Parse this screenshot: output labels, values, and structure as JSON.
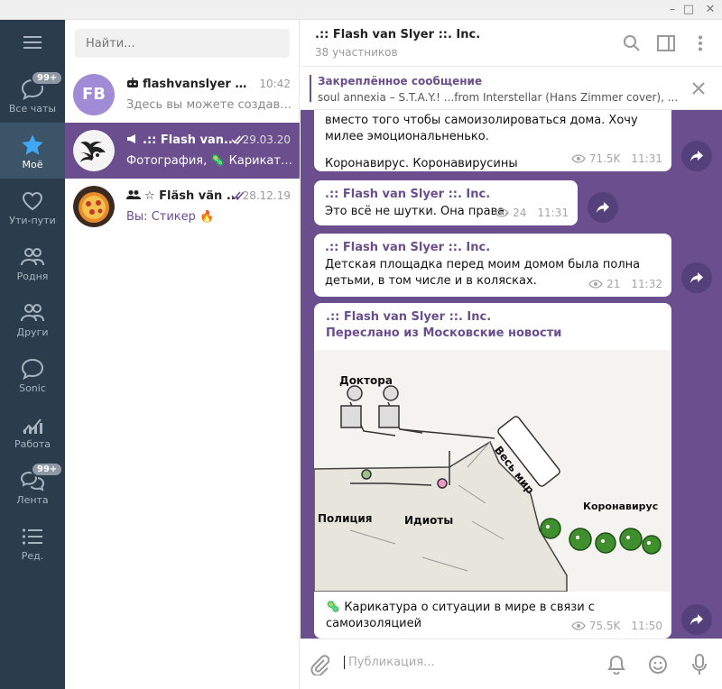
{
  "window": {
    "minimize": "–",
    "maximize": "□",
    "close": "✕"
  },
  "colors": {
    "accent": "#6a4e8e",
    "rail": "#2b3d4d",
    "forward": "#54407a"
  },
  "folders": [
    {
      "label": "Все чаты",
      "icon": "chat-bubble-icon",
      "badge": "99+"
    },
    {
      "label": "Моё",
      "icon": "star-icon",
      "active": true
    },
    {
      "label": "Ути-пути",
      "icon": "heart-icon"
    },
    {
      "label": "Родня",
      "icon": "people-icon"
    },
    {
      "label": "Други",
      "icon": "people-icon"
    },
    {
      "label": "Sonic",
      "icon": "chat-bubble-icon"
    },
    {
      "label": "Работа",
      "icon": "chart-icon"
    },
    {
      "label": "Лента",
      "icon": "chat-bubbles-icon",
      "badge": "99+"
    },
    {
      "label": "Ред.",
      "icon": "list-icon"
    }
  ],
  "search": {
    "placeholder": "Найти..."
  },
  "chats": [
    {
      "avatar": "FB",
      "name": "flashvanslyer bot",
      "time": "10:42",
      "preview": "Здесь вы можете создавать..."
    },
    {
      "name": ".:: Flash van...",
      "time": "29.03.20",
      "preview": "Фотография, 🦠 Карикатур..."
    },
    {
      "name": "☆ Fläsh vän ...",
      "time": "28.12.19",
      "preview": "Вы: Стикер 🔥"
    }
  ],
  "header": {
    "title": ".:: Flash van Slyer ::. Inc.",
    "subtitle": "38 участников"
  },
  "pinned": {
    "title": "Закреплённое сообщение",
    "text": "soul annexia – S.T.A.Y.! ...from Interstellar (Hans Zimmer cover), ..."
  },
  "messages": [
    {
      "text_top": "вместо того чтобы самоизолироваться дома. Хочу милее эмоциональненько.",
      "text": "Коронавирус. Коронавирусины",
      "views": "71.5K",
      "time": "11:31"
    },
    {
      "author": ".:: Flash van Slyer ::. Inc.",
      "text": "Это всё не шутки. Она права.",
      "views": "24",
      "time": "11:31"
    },
    {
      "author": ".:: Flash van Slyer ::. Inc.",
      "text": "Детская площадка перед моим домом была полна детьми, в том числе и в колясках.",
      "views": "21",
      "time": "11:32"
    },
    {
      "author": ".:: Flash van Slyer ::. Inc.",
      "forwarded": "Переслано из Московские новости",
      "image_labels": {
        "doctors": "Доктора",
        "world": "Весь мир",
        "police": "Полиция",
        "idiots": "Идиоты",
        "virus": "Коронавирус"
      },
      "caption": "🦠 Карикатура о ситуации в мире в связи с самоизоляцией",
      "views": "75.5K",
      "time": "11:50"
    }
  ],
  "composer": {
    "placeholder": "Публикация..."
  }
}
